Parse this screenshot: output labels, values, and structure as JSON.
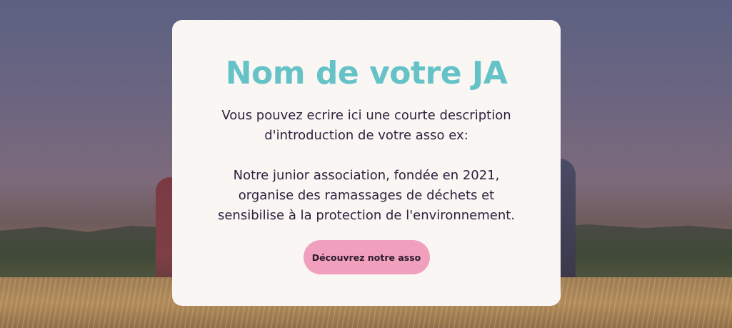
{
  "hero": {
    "title": "Nom de votre JA",
    "description_lines": [
      "Vous pouvez ecrire ici une courte description",
      "d'introduction de votre asso ex:"
    ],
    "example_lines": [
      "Notre junior association, fondée en 2021,",
      "organise des ramassages de déchets et",
      "sensibilise à la protection de l'environnement."
    ],
    "cta_label": "Découvrez notre asso"
  },
  "colors": {
    "title": "#65c3c8",
    "text": "#2c1f3c",
    "button": "#f09fbd",
    "card": "#faf6f3"
  }
}
